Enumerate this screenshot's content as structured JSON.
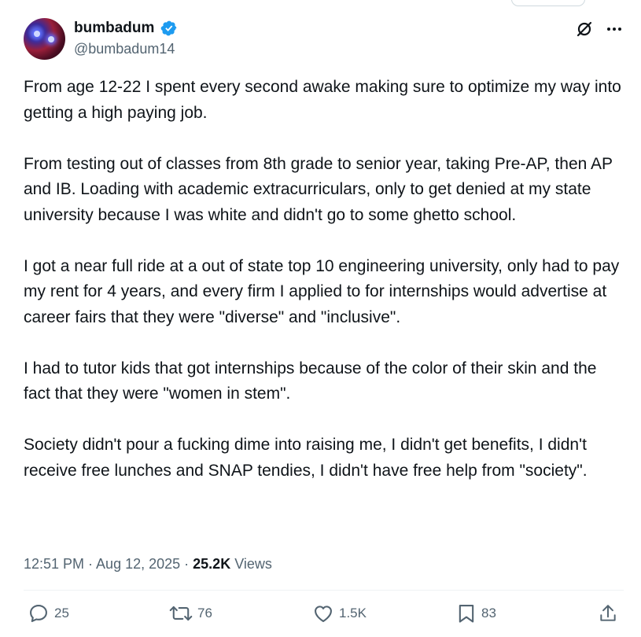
{
  "post": {
    "author": {
      "display_name": "bumbadum",
      "handle": "@bumbadum14",
      "verified_icon": "verified-badge-icon"
    },
    "paragraphs": [
      "From age 12-22 I spent every second awake making sure to optimize my way into getting a high paying job.",
      "From testing out of classes from 8th grade to senior year, taking Pre-AP, then AP and IB. Loading with academic extracurriculars, only to get denied at my state university because I was white and didn't go to some ghetto school.",
      "I got a near full ride at a out of state top 10 engineering university, only had to pay my rent for 4 years, and every firm I applied to for internships would advertise at career fairs that they were \"diverse\" and \"inclusive\".",
      "I had to tutor kids that got internships because of the color of their skin and the fact that they were \"women in stem\".",
      "Society didn't pour a fucking dime into raising me, I didn't get benefits, I didn't receive free lunches and SNAP tendies, I didn't have free help from \"society\"."
    ],
    "timestamp": "12:51 PM · Aug 12, 2025",
    "separator": " · ",
    "views_count": "25.2K",
    "views_label": "Views"
  },
  "actions": {
    "replies": "25",
    "reposts": "76",
    "likes": "1.5K",
    "bookmarks": "83"
  },
  "colors": {
    "text": "#0f1419",
    "secondary": "#536471",
    "verified": "#1d9bf0",
    "divider": "#eff3f4"
  }
}
